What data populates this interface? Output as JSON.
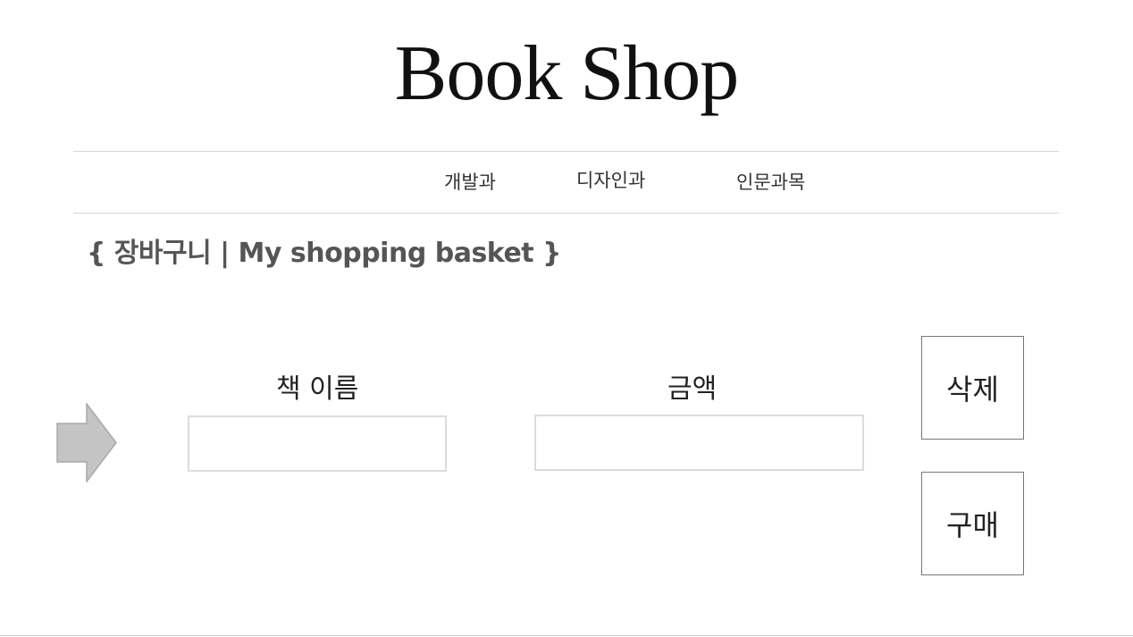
{
  "header": {
    "logo_text": "Book Shop"
  },
  "nav": {
    "items": [
      {
        "label": "개발과"
      },
      {
        "label": "디자인과"
      },
      {
        "label": "인문과목"
      }
    ]
  },
  "basket": {
    "title": "{ 장바구니 | My shopping basket }",
    "columns": {
      "book_name": "책 이름",
      "price": "금액"
    },
    "fields": {
      "book_name_value": "",
      "price_value": ""
    },
    "buttons": {
      "delete_label": "삭제",
      "buy_label": "구매"
    }
  },
  "icons": {
    "row_pointer": "arrow-right-icon"
  },
  "colors": {
    "arrow_fill": "#c4c4c4",
    "arrow_stroke": "#a9a9a9",
    "divider": "#d6d6d6",
    "title_text": "#555555"
  }
}
